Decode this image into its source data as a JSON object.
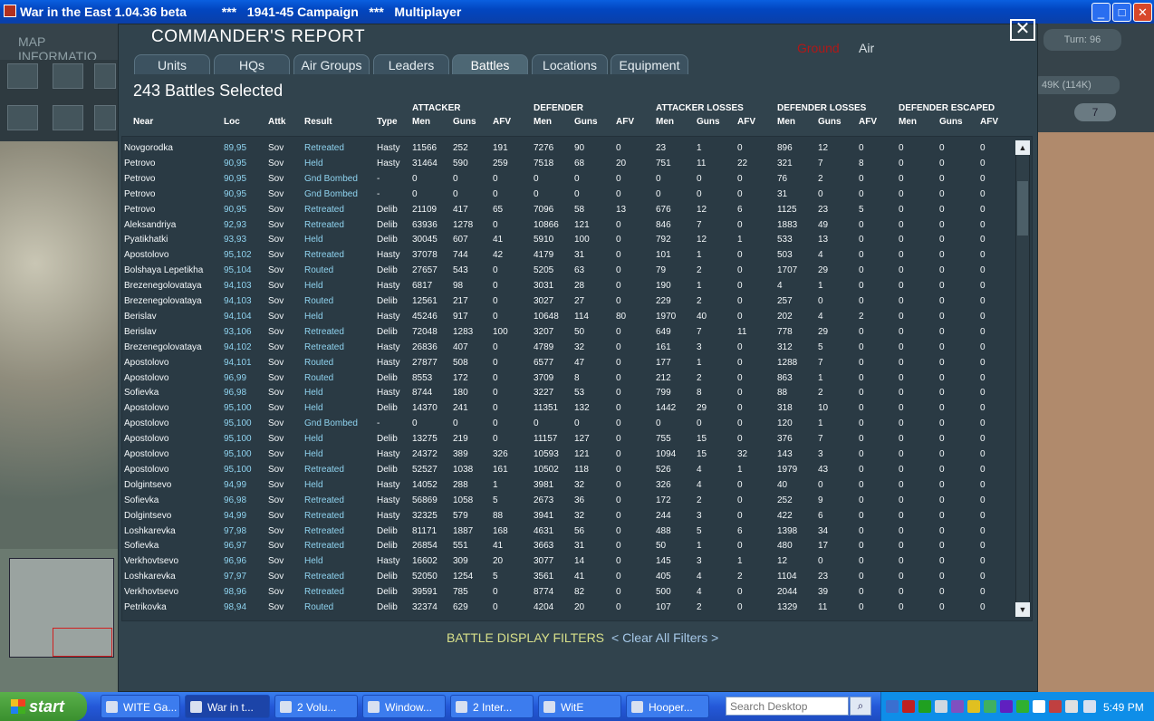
{
  "window": {
    "title": "War in the East 1.04.36 beta          ***   1941-45 Campaign   ***   Multiplayer",
    "min": "_",
    "max": "□",
    "close": "✕"
  },
  "map": {
    "info_label": "MAP INFORMATIO",
    "turn_label": "Turn: 96",
    "supply_label": "49K (114K)",
    "pill_label": "7"
  },
  "report": {
    "title": "COMMANDER'S REPORT",
    "ground_label": "Ground",
    "air_label": "Air",
    "close_label": "✕",
    "tabs": [
      {
        "label": "Units"
      },
      {
        "label": "HQs"
      },
      {
        "label": "Air Groups"
      },
      {
        "label": "Leaders"
      },
      {
        "label": "Battles"
      },
      {
        "label": "Locations"
      },
      {
        "label": "Equipment"
      }
    ],
    "selected_count": "243 Battles Selected",
    "groups": {
      "attacker": "ATTACKER",
      "defender": "DEFENDER",
      "attacker_losses": "ATTACKER LOSSES",
      "defender_losses": "DEFENDER LOSSES",
      "defender_escaped": "DEFENDER ESCAPED"
    },
    "columns": [
      "Near",
      "Loc",
      "Attk",
      "Result",
      "Type",
      "Men",
      "Guns",
      "AFV",
      "Men",
      "Guns",
      "AFV",
      "Men",
      "Guns",
      "AFV",
      "Men",
      "Guns",
      "AFV",
      "Men",
      "Guns",
      "AFV"
    ],
    "rows": [
      [
        "Novgorodka",
        "89,95",
        "Sov",
        "Retreated",
        "Hasty",
        "11566",
        "252",
        "191",
        "7276",
        "90",
        "0",
        "23",
        "1",
        "0",
        "896",
        "12",
        "0",
        "0",
        "0",
        "0"
      ],
      [
        "Petrovo",
        "90,95",
        "Sov",
        "Held",
        "Hasty",
        "31464",
        "590",
        "259",
        "7518",
        "68",
        "20",
        "751",
        "11",
        "22",
        "321",
        "7",
        "8",
        "0",
        "0",
        "0"
      ],
      [
        "Petrovo",
        "90,95",
        "Sov",
        "Gnd Bombed",
        "-",
        "0",
        "0",
        "0",
        "0",
        "0",
        "0",
        "0",
        "0",
        "0",
        "76",
        "2",
        "0",
        "0",
        "0",
        "0"
      ],
      [
        "Petrovo",
        "90,95",
        "Sov",
        "Gnd Bombed",
        "-",
        "0",
        "0",
        "0",
        "0",
        "0",
        "0",
        "0",
        "0",
        "0",
        "31",
        "0",
        "0",
        "0",
        "0",
        "0"
      ],
      [
        "Petrovo",
        "90,95",
        "Sov",
        "Retreated",
        "Delib",
        "21109",
        "417",
        "65",
        "7096",
        "58",
        "13",
        "676",
        "12",
        "6",
        "1125",
        "23",
        "5",
        "0",
        "0",
        "0"
      ],
      [
        "Aleksandriya",
        "92,93",
        "Sov",
        "Retreated",
        "Delib",
        "63936",
        "1278",
        "0",
        "10866",
        "121",
        "0",
        "846",
        "7",
        "0",
        "1883",
        "49",
        "0",
        "0",
        "0",
        "0"
      ],
      [
        "Pyatikhatki",
        "93,93",
        "Sov",
        "Held",
        "Delib",
        "30045",
        "607",
        "41",
        "5910",
        "100",
        "0",
        "792",
        "12",
        "1",
        "533",
        "13",
        "0",
        "0",
        "0",
        "0"
      ],
      [
        "Apostolovo",
        "95,102",
        "Sov",
        "Retreated",
        "Hasty",
        "37078",
        "744",
        "42",
        "4179",
        "31",
        "0",
        "101",
        "1",
        "0",
        "503",
        "4",
        "0",
        "0",
        "0",
        "0"
      ],
      [
        "Bolshaya Lepetikha",
        "95,104",
        "Sov",
        "Routed",
        "Delib",
        "27657",
        "543",
        "0",
        "5205",
        "63",
        "0",
        "79",
        "2",
        "0",
        "1707",
        "29",
        "0",
        "0",
        "0",
        "0"
      ],
      [
        "Brezenegolovataya",
        "94,103",
        "Sov",
        "Held",
        "Hasty",
        "6817",
        "98",
        "0",
        "3031",
        "28",
        "0",
        "190",
        "1",
        "0",
        "4",
        "1",
        "0",
        "0",
        "0",
        "0"
      ],
      [
        "Brezenegolovataya",
        "94,103",
        "Sov",
        "Routed",
        "Delib",
        "12561",
        "217",
        "0",
        "3027",
        "27",
        "0",
        "229",
        "2",
        "0",
        "257",
        "0",
        "0",
        "0",
        "0",
        "0"
      ],
      [
        "Berislav",
        "94,104",
        "Sov",
        "Held",
        "Hasty",
        "45246",
        "917",
        "0",
        "10648",
        "114",
        "80",
        "1970",
        "40",
        "0",
        "202",
        "4",
        "2",
        "0",
        "0",
        "0"
      ],
      [
        "Berislav",
        "93,106",
        "Sov",
        "Retreated",
        "Delib",
        "72048",
        "1283",
        "100",
        "3207",
        "50",
        "0",
        "649",
        "7",
        "11",
        "778",
        "29",
        "0",
        "0",
        "0",
        "0"
      ],
      [
        "Brezenegolovataya",
        "94,102",
        "Sov",
        "Retreated",
        "Hasty",
        "26836",
        "407",
        "0",
        "4789",
        "32",
        "0",
        "161",
        "3",
        "0",
        "312",
        "5",
        "0",
        "0",
        "0",
        "0"
      ],
      [
        "Apostolovo",
        "94,101",
        "Sov",
        "Routed",
        "Hasty",
        "27877",
        "508",
        "0",
        "6577",
        "47",
        "0",
        "177",
        "1",
        "0",
        "1288",
        "7",
        "0",
        "0",
        "0",
        "0"
      ],
      [
        "Apostolovo",
        "96,99",
        "Sov",
        "Routed",
        "Delib",
        "8553",
        "172",
        "0",
        "3709",
        "8",
        "0",
        "212",
        "2",
        "0",
        "863",
        "1",
        "0",
        "0",
        "0",
        "0"
      ],
      [
        "Sofievka",
        "96,98",
        "Sov",
        "Held",
        "Hasty",
        "8744",
        "180",
        "0",
        "3227",
        "53",
        "0",
        "799",
        "8",
        "0",
        "88",
        "2",
        "0",
        "0",
        "0",
        "0"
      ],
      [
        "Apostolovo",
        "95,100",
        "Sov",
        "Held",
        "Delib",
        "14370",
        "241",
        "0",
        "11351",
        "132",
        "0",
        "1442",
        "29",
        "0",
        "318",
        "10",
        "0",
        "0",
        "0",
        "0"
      ],
      [
        "Apostolovo",
        "95,100",
        "Sov",
        "Gnd Bombed",
        "-",
        "0",
        "0",
        "0",
        "0",
        "0",
        "0",
        "0",
        "0",
        "0",
        "120",
        "1",
        "0",
        "0",
        "0",
        "0"
      ],
      [
        "Apostolovo",
        "95,100",
        "Sov",
        "Held",
        "Delib",
        "13275",
        "219",
        "0",
        "11157",
        "127",
        "0",
        "755",
        "15",
        "0",
        "376",
        "7",
        "0",
        "0",
        "0",
        "0"
      ],
      [
        "Apostolovo",
        "95,100",
        "Sov",
        "Held",
        "Hasty",
        "24372",
        "389",
        "326",
        "10593",
        "121",
        "0",
        "1094",
        "15",
        "32",
        "143",
        "3",
        "0",
        "0",
        "0",
        "0"
      ],
      [
        "Apostolovo",
        "95,100",
        "Sov",
        "Retreated",
        "Delib",
        "52527",
        "1038",
        "161",
        "10502",
        "118",
        "0",
        "526",
        "4",
        "1",
        "1979",
        "43",
        "0",
        "0",
        "0",
        "0"
      ],
      [
        "Dolgintsevo",
        "94,99",
        "Sov",
        "Held",
        "Hasty",
        "14052",
        "288",
        "1",
        "3981",
        "32",
        "0",
        "326",
        "4",
        "0",
        "40",
        "0",
        "0",
        "0",
        "0",
        "0"
      ],
      [
        "Sofievka",
        "96,98",
        "Sov",
        "Retreated",
        "Hasty",
        "56869",
        "1058",
        "5",
        "2673",
        "36",
        "0",
        "172",
        "2",
        "0",
        "252",
        "9",
        "0",
        "0",
        "0",
        "0"
      ],
      [
        "Dolgintsevo",
        "94,99",
        "Sov",
        "Retreated",
        "Hasty",
        "32325",
        "579",
        "88",
        "3941",
        "32",
        "0",
        "244",
        "3",
        "0",
        "422",
        "6",
        "0",
        "0",
        "0",
        "0"
      ],
      [
        "Loshkarevka",
        "97,98",
        "Sov",
        "Retreated",
        "Delib",
        "81171",
        "1887",
        "168",
        "4631",
        "56",
        "0",
        "488",
        "5",
        "6",
        "1398",
        "34",
        "0",
        "0",
        "0",
        "0"
      ],
      [
        "Sofievka",
        "96,97",
        "Sov",
        "Retreated",
        "Delib",
        "26854",
        "551",
        "41",
        "3663",
        "31",
        "0",
        "50",
        "1",
        "0",
        "480",
        "17",
        "0",
        "0",
        "0",
        "0"
      ],
      [
        "Verkhovtsevo",
        "96,96",
        "Sov",
        "Held",
        "Hasty",
        "16602",
        "309",
        "20",
        "3077",
        "14",
        "0",
        "145",
        "3",
        "1",
        "12",
        "0",
        "0",
        "0",
        "0",
        "0"
      ],
      [
        "Loshkarevka",
        "97,97",
        "Sov",
        "Retreated",
        "Delib",
        "52050",
        "1254",
        "5",
        "3561",
        "41",
        "0",
        "405",
        "4",
        "2",
        "1104",
        "23",
        "0",
        "0",
        "0",
        "0"
      ],
      [
        "Verkhovtsevo",
        "98,96",
        "Sov",
        "Retreated",
        "Delib",
        "39591",
        "785",
        "0",
        "8774",
        "82",
        "0",
        "500",
        "4",
        "0",
        "2044",
        "39",
        "0",
        "0",
        "0",
        "0"
      ],
      [
        "Petrikovka",
        "98,94",
        "Sov",
        "Routed",
        "Delib",
        "32374",
        "629",
        "0",
        "4204",
        "20",
        "0",
        "107",
        "2",
        "0",
        "1329",
        "11",
        "0",
        "0",
        "0",
        "0"
      ]
    ],
    "filters_label": "BATTLE DISPLAY FILTERS",
    "clear_label": "< Clear All Filters >",
    "scroll_up": "▲",
    "scroll_down": "▼"
  },
  "taskbar": {
    "start_label": "start",
    "tasks": [
      {
        "label": "WITE Ga..."
      },
      {
        "label": "War in t..."
      },
      {
        "label": "2 Volu..."
      },
      {
        "label": "Window..."
      },
      {
        "label": "2 Inter..."
      },
      {
        "label": "WitE"
      },
      {
        "label": "Hooper..."
      }
    ],
    "search_placeholder": "Search Desktop",
    "search_icon": "⌕",
    "clock": "5:49 PM"
  },
  "colors": {
    "panel": "#31434d",
    "result_cyan": "#8fd3ef",
    "ground_red": "#b01818",
    "filters_yellow": "#d8e08a"
  }
}
